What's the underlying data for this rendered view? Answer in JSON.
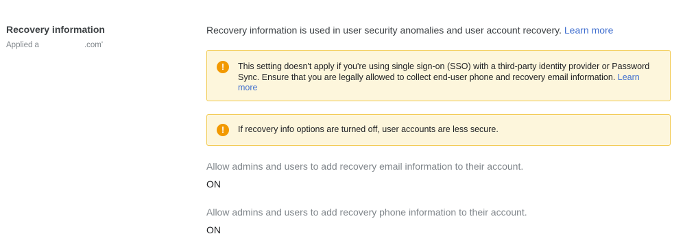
{
  "section": {
    "title": "Recovery information",
    "applied_prefix": "Applied a",
    "applied_suffix": ".com'"
  },
  "intro": {
    "text": "Recovery information is used in user security anomalies and user account recovery. ",
    "link": "Learn more"
  },
  "notices": [
    {
      "icon": "warning-icon",
      "icon_glyph": "!",
      "text": "This setting doesn't apply if you're using single sign-on (SSO) with a third-party identity provider or Password Sync. Ensure that you are legally allowed to collect end-user phone and recovery email information. ",
      "link": "Learn more"
    },
    {
      "icon": "warning-icon",
      "icon_glyph": "!",
      "text": "If recovery info options are turned off, user accounts are less secure."
    }
  ],
  "settings": [
    {
      "label": "Allow admins and users to add recovery email information to their account.",
      "value": "ON"
    },
    {
      "label": "Allow admins and users to add recovery phone information to their account.",
      "value": "ON"
    }
  ],
  "colors": {
    "link": "#3f6ecf",
    "notice_bg": "#fdf6dc",
    "notice_border": "#f2c94c",
    "warning_icon": "#f29900"
  }
}
